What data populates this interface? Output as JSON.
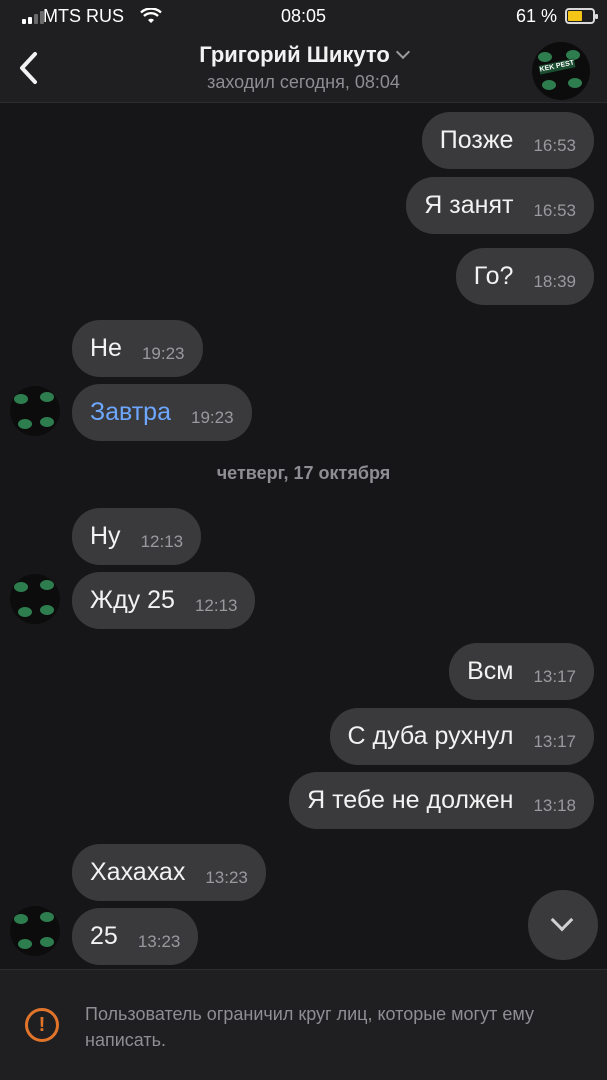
{
  "status_bar": {
    "carrier": "MTS RUS",
    "time": "08:05",
    "battery_percent": "61 %",
    "battery_level": 0.61,
    "signal_bars": 4,
    "signal_active": 2,
    "wifi_icon": "wifi-icon"
  },
  "header": {
    "back_icon": "chevron-left-icon",
    "contact_name": "Григорий Шикуто",
    "last_seen": "заходил сегодня, 08:04",
    "dropdown_icon": "chevron-down-icon",
    "avatar_text": "KEK PEST"
  },
  "messages": [
    {
      "text": "Позже",
      "time": "16:53",
      "outgoing": true
    },
    {
      "text": "Я занят",
      "time": "16:53",
      "outgoing": true
    },
    {
      "text": "Го?",
      "time": "18:39",
      "outgoing": true
    },
    {
      "text": "Не",
      "time": "19:23",
      "outgoing": false
    },
    {
      "text": "Завтра",
      "time": "19:23",
      "outgoing": false,
      "link": true
    },
    {
      "text": "Ну",
      "time": "12:13",
      "outgoing": false
    },
    {
      "text": "Жду 25",
      "time": "12:13",
      "outgoing": false
    },
    {
      "text": "Всм",
      "time": "13:17",
      "outgoing": true
    },
    {
      "text": "С дуба рухнул",
      "time": "13:17",
      "outgoing": true
    },
    {
      "text": "Я тебе не должен",
      "time": "13:18",
      "outgoing": true
    },
    {
      "text": "Хахахах",
      "time": "13:23",
      "outgoing": false
    },
    {
      "text": "25",
      "time": "13:23",
      "outgoing": false
    }
  ],
  "date_separator": "четверг, 17 октября",
  "footer": {
    "warning_icon": "exclamation-circle-icon",
    "notice": "Пользователь ограничил круг лиц, которые могут ему написать."
  },
  "colors": {
    "background": "#161618",
    "bubble": "#3a3a3c",
    "link": "#6ea7ff",
    "warning": "#e0742a",
    "battery": "#f5c518"
  }
}
